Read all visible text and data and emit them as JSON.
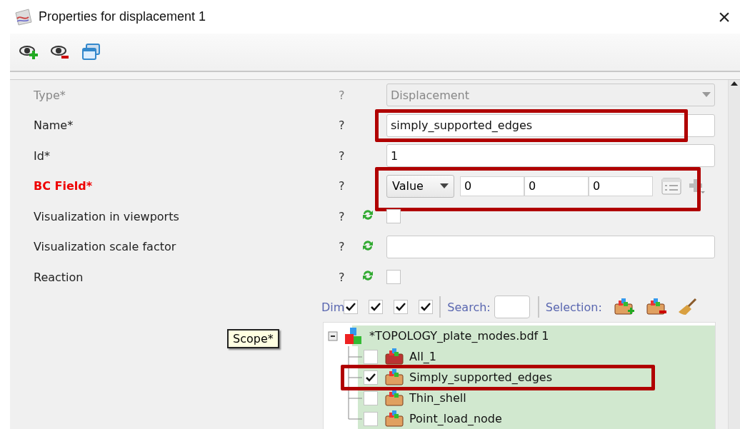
{
  "window": {
    "title": "Properties for displacement 1",
    "close": "×"
  },
  "form": {
    "rows": [
      {
        "label": "Type*",
        "kind": "combo",
        "value": "Displacement",
        "disabled": true,
        "required_missing": false,
        "highlighted": false,
        "refresh": false
      },
      {
        "label": "Name*",
        "kind": "text",
        "value": "simply_supported_edges",
        "disabled": false,
        "required_missing": false,
        "highlighted": true,
        "refresh": false
      },
      {
        "label": "Id*",
        "kind": "text",
        "value": "1",
        "disabled": false,
        "required_missing": false,
        "highlighted": false,
        "refresh": false
      },
      {
        "label": "BC Field*",
        "kind": "vector",
        "mode": "Value",
        "values": [
          "0",
          "0",
          "0"
        ],
        "disabled": false,
        "required_missing": true,
        "highlighted": true,
        "refresh": false
      },
      {
        "label": "Visualization in viewports",
        "kind": "checkbox",
        "checked": false,
        "disabled": false,
        "required_missing": false,
        "highlighted": false,
        "refresh": true
      },
      {
        "label": "Visualization scale factor",
        "kind": "text",
        "disabled": false,
        "required_missing": false,
        "highlighted": false,
        "refresh": true
      },
      {
        "label": "Reaction",
        "kind": "checkbox",
        "checked": false,
        "disabled": false,
        "required_missing": false,
        "highlighted": false,
        "refresh": true
      }
    ],
    "help": "?"
  },
  "scope": {
    "tooltip": "Scope*",
    "dim_label": "Dim",
    "dims": [
      {
        "checked": true
      },
      {
        "checked": true
      },
      {
        "checked": true
      },
      {
        "checked": true
      }
    ],
    "search_label": "Search:",
    "selection_label": "Selection:",
    "tree": {
      "label": "*TOPOLOGY_plate_modes.bdf 1",
      "expanded": true,
      "children": [
        {
          "label": "All_1",
          "kind": "all",
          "checked": false,
          "highlighted": false
        },
        {
          "label": "Simply_supported_edges",
          "kind": "set",
          "checked": true,
          "highlighted": true
        },
        {
          "label": "Thin_shell",
          "kind": "set",
          "checked": false,
          "highlighted": false
        },
        {
          "label": "Point_load_node",
          "kind": "set",
          "checked": false,
          "highlighted": false
        }
      ]
    }
  }
}
